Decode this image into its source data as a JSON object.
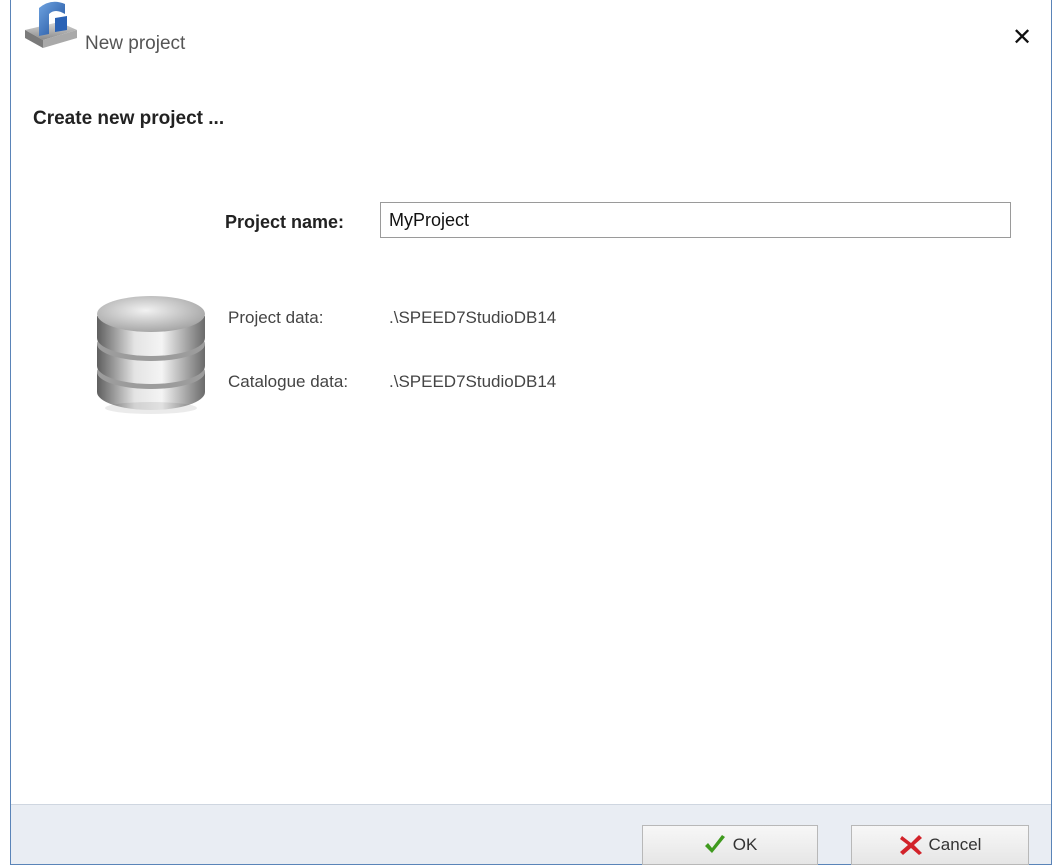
{
  "window": {
    "title": "New project",
    "close_glyph": "✕"
  },
  "icons": {
    "app": "app-logo-icon",
    "close": "close-icon",
    "database": "database-icon",
    "ok": "checkmark-icon",
    "cancel": "cancel-x-icon"
  },
  "dialog": {
    "heading": "Create new project ...",
    "project_name_label": "Project name:",
    "project_name_value": "MyProject",
    "project_data_label": "Project data:",
    "project_data_value": ".\\SPEED7StudioDB14",
    "catalogue_data_label": "Catalogue data:",
    "catalogue_data_value": ".\\SPEED7StudioDB14"
  },
  "footer": {
    "ok_label": "OK",
    "cancel_label": "Cancel"
  },
  "colors": {
    "window_border": "#5a84b8",
    "footer_bg": "#e9edf3",
    "ok_check": "#3f9a1e",
    "cancel_x": "#d2232a"
  }
}
